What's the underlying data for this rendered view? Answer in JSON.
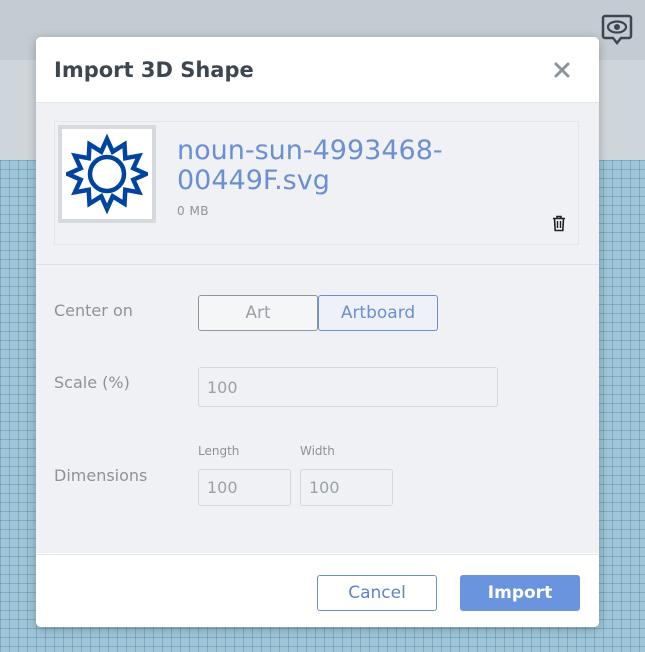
{
  "dialog": {
    "title": "Import 3D Shape",
    "close_label": "×"
  },
  "file": {
    "name": "noun-sun-4993468-00449F.svg",
    "size": "0 MB",
    "icon": "sun-icon",
    "icon_color": "#00449F"
  },
  "form": {
    "center_on": {
      "label": "Center on",
      "options": [
        "Art",
        "Artboard"
      ],
      "selected": "Artboard"
    },
    "scale": {
      "label": "Scale (%)",
      "placeholder": "100"
    },
    "dimensions": {
      "label": "Dimensions",
      "length_label": "Length",
      "length_placeholder": "100",
      "width_label": "Width",
      "width_placeholder": "100"
    }
  },
  "footer": {
    "cancel_label": "Cancel",
    "import_label": "Import"
  },
  "colors": {
    "accent": "#6b94de",
    "link_text": "#6b8fcf"
  }
}
